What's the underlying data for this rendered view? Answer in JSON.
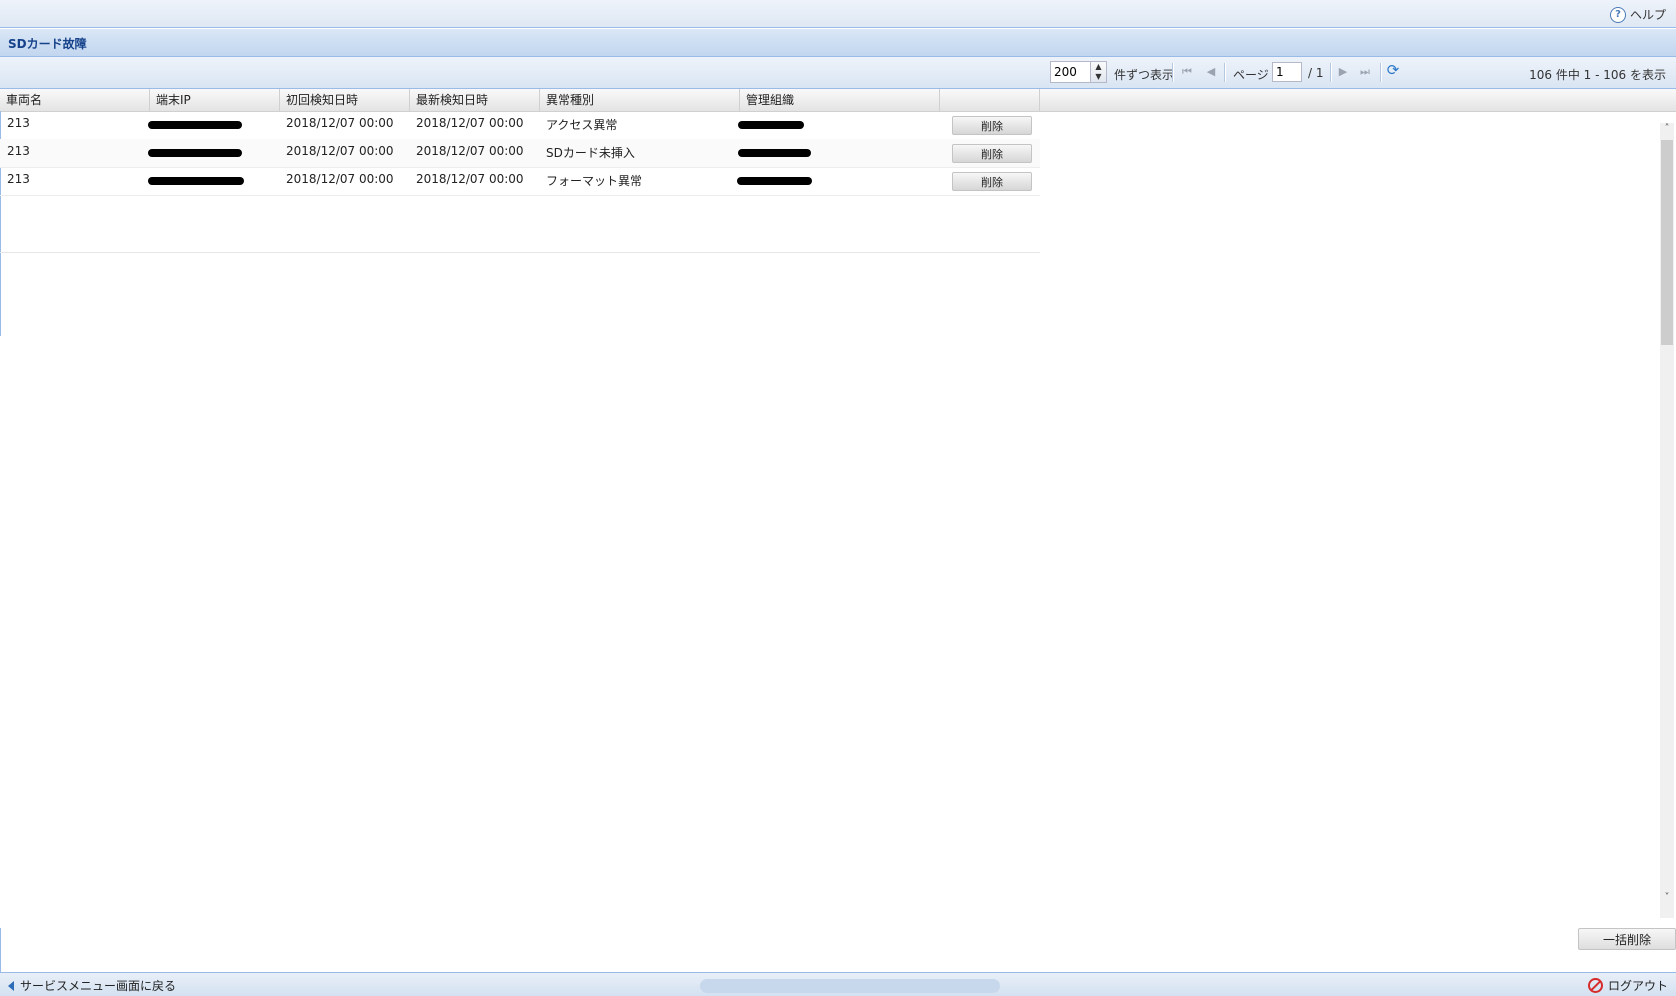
{
  "header": {
    "help_label": "ヘルプ",
    "help_icon": "question-icon"
  },
  "panel": {
    "title": "SDカード故障"
  },
  "toolbar": {
    "page_size": "200",
    "page_size_suffix": "件ずつ表示",
    "page_label": "ページ",
    "current_page": "1",
    "total_pages": "/ 1",
    "summary": "106 件中 1 - 106 を表示"
  },
  "grid": {
    "columns": [
      "車両名",
      "端末IP",
      "初回検知日時",
      "最新検知日時",
      "異常種別",
      "管理組織"
    ],
    "delete_label": "削除",
    "rows": [
      {
        "vehicle": "213",
        "first_detected": "2018/12/07 00:00",
        "last_detected": "2018/12/07 00:00",
        "type": "アクセス異常"
      },
      {
        "vehicle": "213",
        "first_detected": "2018/12/07 00:00",
        "last_detected": "2018/12/07 00:00",
        "type": "SDカード未挿入"
      },
      {
        "vehicle": "213",
        "first_detected": "2018/12/07 00:00",
        "last_detected": "2018/12/07 00:00",
        "type": "フォーマット異常"
      }
    ]
  },
  "bulk_delete_label": "一括削除",
  "footer": {
    "back_label": "サービスメニュー画面に戻る",
    "logout_label": "ログアウト"
  },
  "colors": {
    "accent": "#15428b",
    "border": "#99bbe8",
    "logout": "#d62b2b"
  }
}
